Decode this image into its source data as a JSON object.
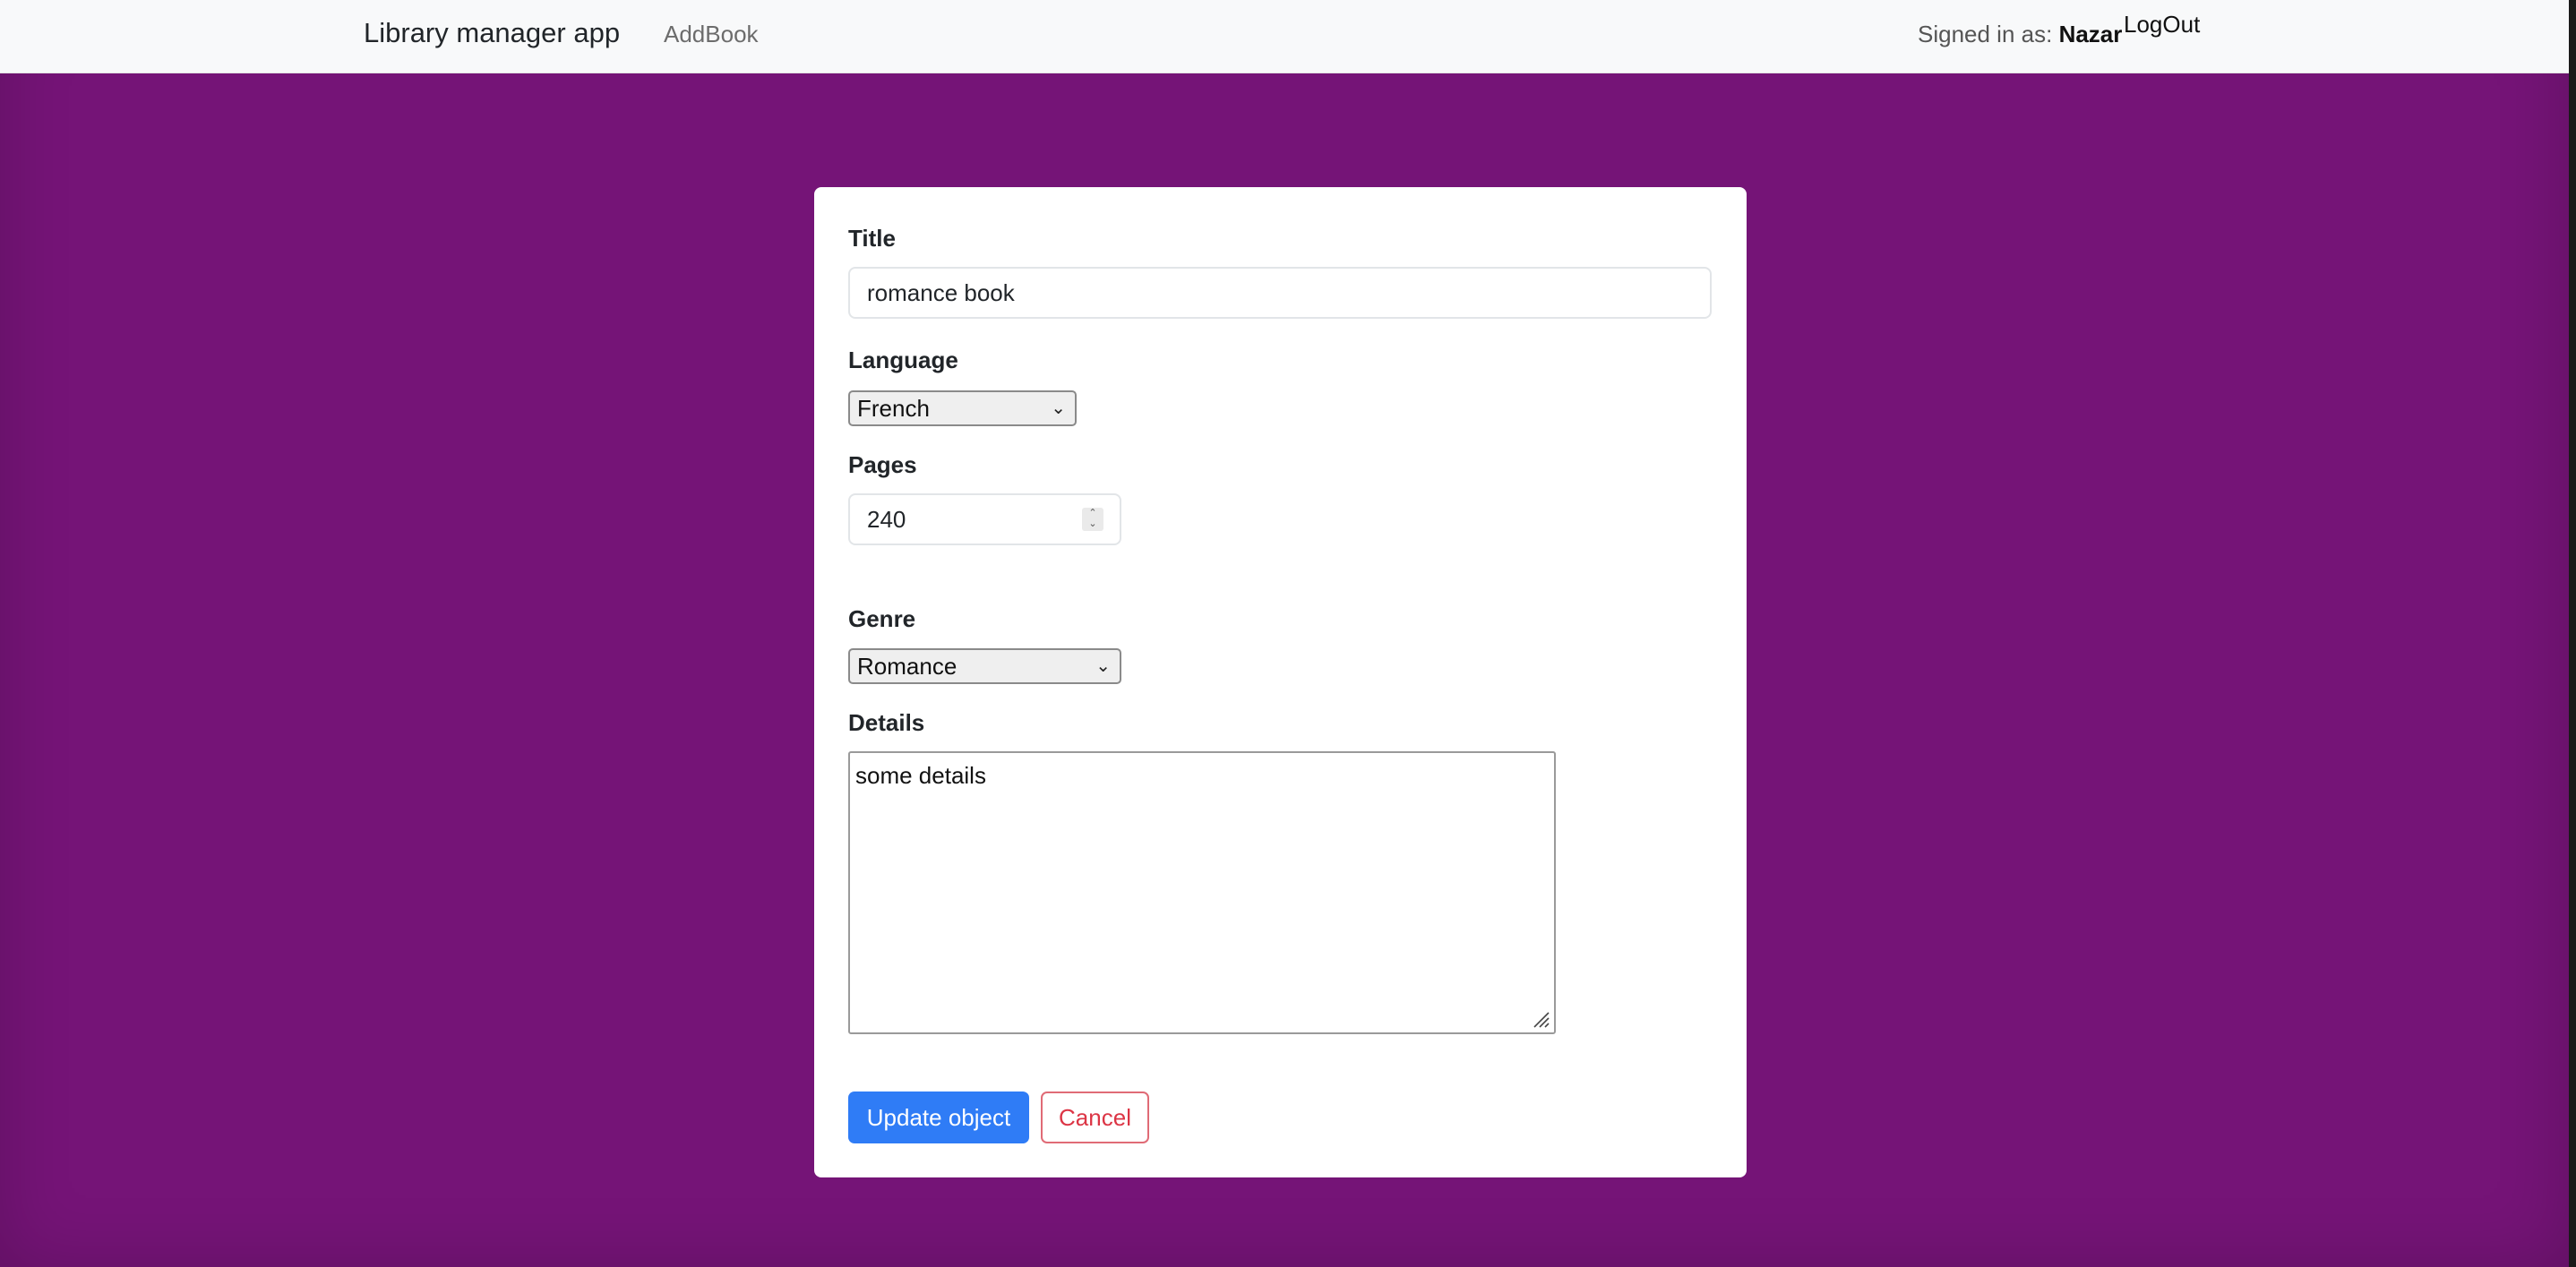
{
  "navbar": {
    "brand": "Library manager app",
    "add_book_link": "AddBook",
    "signed_in_label": "Signed in as:",
    "user_name": "Nazar",
    "logout_link": "LogOut"
  },
  "form": {
    "title": {
      "label": "Title",
      "value": "romance book"
    },
    "language": {
      "label": "Language",
      "selected": "French"
    },
    "pages": {
      "label": "Pages",
      "value": "240"
    },
    "genre": {
      "label": "Genre",
      "selected": "Romance"
    },
    "details": {
      "label": "Details",
      "value": "some details"
    },
    "submit_label": "Update object",
    "cancel_label": "Cancel"
  },
  "colors": {
    "page_background": "#751477",
    "navbar_background": "#f8f9fa",
    "primary_button": "#2f7cf6",
    "cancel_text": "#dc3545"
  },
  "icons": {
    "select_arrow": "chevron-down-icon",
    "number_spinner": "spinner-arrows-icon",
    "textarea_resize": "resize-grip-icon"
  }
}
